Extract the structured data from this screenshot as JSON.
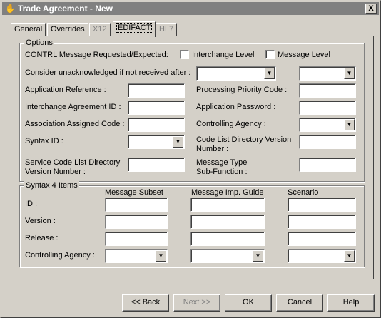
{
  "window": {
    "title": "Trade Agreement - New",
    "close_label": "X",
    "app_icon": "handshake-icon"
  },
  "tabs": [
    {
      "label": "General",
      "state": "normal"
    },
    {
      "label": "Overrides",
      "state": "normal"
    },
    {
      "label": "X12",
      "state": "disabled"
    },
    {
      "label": "EDIFACT",
      "state": "active"
    },
    {
      "label": "HL7",
      "state": "disabled"
    }
  ],
  "options": {
    "legend": "Options",
    "contrl_label": "CONTRL Message Requested/Expected:",
    "interchange_level_label": "Interchange Level",
    "interchange_level_checked": false,
    "message_level_label": "Message Level",
    "message_level_checked": false,
    "unack_label": "Consider unacknowledged if not received after :",
    "unack_value": "",
    "unack_unit_value": "",
    "app_reference_label": "Application Reference :",
    "app_reference_value": "",
    "processing_priority_label": "Processing Priority Code :",
    "processing_priority_value": "",
    "interchange_agreement_label": "Interchange Agreement ID :",
    "interchange_agreement_value": "",
    "app_password_label": "Application Password :",
    "app_password_value": "",
    "association_code_label": "Association Assigned Code :",
    "association_code_value": "",
    "controlling_agency_label": "Controlling Agency :",
    "controlling_agency_value": "",
    "syntax_id_label": "Syntax ID :",
    "syntax_id_value": "",
    "code_list_label_1": "Code List Directory Version",
    "code_list_label_2": "Number :",
    "code_list_value": "",
    "service_code_label_1": "Service Code List Directory",
    "service_code_label_2": "Version Number :",
    "service_code_value": "",
    "message_type_label_1": "Message Type",
    "message_type_label_2": "Sub-Function :",
    "message_type_value": ""
  },
  "syntax4": {
    "legend": "Syntax 4 Items",
    "columns": [
      "Message Subset",
      "Message Imp. Guide",
      "Scenario"
    ],
    "rows": [
      {
        "label": "ID :",
        "kind": "text"
      },
      {
        "label": "Version :",
        "kind": "text"
      },
      {
        "label": "Release :",
        "kind": "text"
      },
      {
        "label": "Controlling Agency :",
        "kind": "dropdown"
      }
    ]
  },
  "buttons": {
    "back": "<< Back",
    "next": "Next >>",
    "ok": "OK",
    "cancel": "Cancel",
    "help": "Help"
  }
}
